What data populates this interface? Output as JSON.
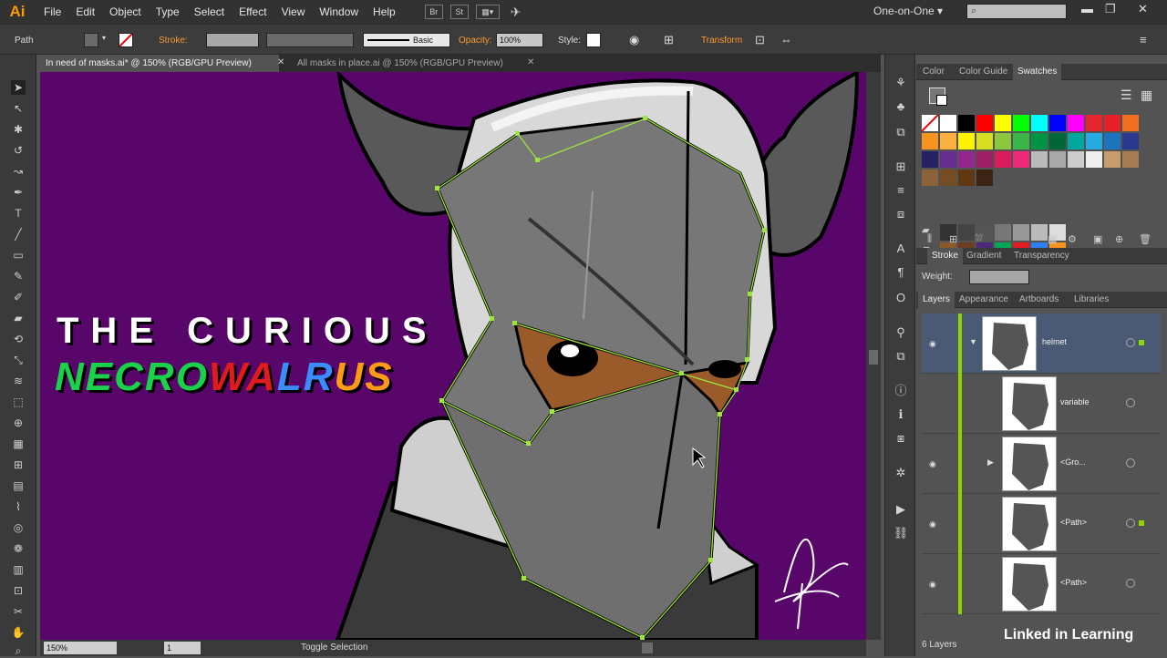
{
  "app": {
    "logo": "Ai",
    "workspace": "One-on-One"
  },
  "menu": [
    "File",
    "Edit",
    "Object",
    "Type",
    "Select",
    "Effect",
    "View",
    "Window",
    "Help"
  ],
  "menu_buttons": [
    "Br",
    "St"
  ],
  "control": {
    "path_label": "Path",
    "stroke_label": "Stroke:",
    "brush_label": "Basic",
    "opacity_label": "Opacity:",
    "opacity_value": "100%",
    "style_label": "Style:",
    "transform_label": "Transform"
  },
  "tabs": [
    {
      "label": "In need of masks.ai* @ 150% (RGB/GPU Preview)"
    },
    {
      "label": "All masks in place.ai @ 150% (RGB/GPU Preview)"
    }
  ],
  "artwork": {
    "title_line1": "THE CURIOUS",
    "title_line2": [
      "N",
      "E",
      "C",
      "R",
      "O",
      "W",
      "A",
      "L",
      "R",
      "U",
      "S"
    ],
    "title_line2_colors": [
      "#19d14a",
      "#19d14a",
      "#19d14a",
      "#19d14a",
      "#19d14a",
      "#e01b1b",
      "#e01b1b",
      "#3a8cff",
      "#3a8cff",
      "#ff9a14",
      "#ff9a14"
    ]
  },
  "status": {
    "zoom": "150%",
    "artboard": "1",
    "mode": "Toggle Selection"
  },
  "swatches_panel": {
    "tabs": [
      "Color",
      "Color Guide",
      "Swatches"
    ],
    "rows": [
      [
        "#ffffff",
        "#ffffff",
        "#000000",
        "#ff0000",
        "#ffff00",
        "#00ff00",
        "#00ffff",
        "#0000ff",
        "#ff00ff",
        "#e6262f",
        "#e82027",
        "#f07020"
      ],
      [
        "#f7941d",
        "#fbb040",
        "#fff200",
        "#d7df23",
        "#8dc63f",
        "#39b54a",
        "#009444",
        "#006838",
        "#00a79d",
        "#27aae1",
        "#1c75bc",
        "#2b3990"
      ],
      [
        "#262262",
        "#662d91",
        "#92278f",
        "#9e1f63",
        "#da1c5c",
        "#ee2a7b",
        "#bbbbbb",
        "#aaaaaa",
        "#cccccc",
        "#eeeeee",
        "#c69c6d",
        "#a67c52"
      ],
      [
        "#8c6239",
        "#754c24",
        "#603913",
        "#3c2415"
      ]
    ],
    "group1": [
      "#333333",
      "#444444",
      "#555555",
      "#777777",
      "#999999",
      "#bbbbbb",
      "#dddddd"
    ],
    "group2": [
      "#8b5a2b",
      "#6b3e1f",
      "#4b2a7b",
      "#00a651",
      "#e11b22",
      "#2e7ff0",
      "#f7941d"
    ]
  },
  "stroke_panel": {
    "tabs": [
      "Stroke",
      "Gradient",
      "Transparency"
    ],
    "weight_label": "Weight:"
  },
  "layers_panel": {
    "tabs": [
      "Layers",
      "Appearance",
      "Artboards",
      "Libraries"
    ],
    "layers": [
      {
        "name": "helmet"
      },
      {
        "name": "variable"
      },
      {
        "name": "<Gro..."
      },
      {
        "name": "<Path>"
      },
      {
        "name": "<Path>"
      }
    ],
    "count": "6 Layers"
  },
  "watermark": "Linked in Learning"
}
